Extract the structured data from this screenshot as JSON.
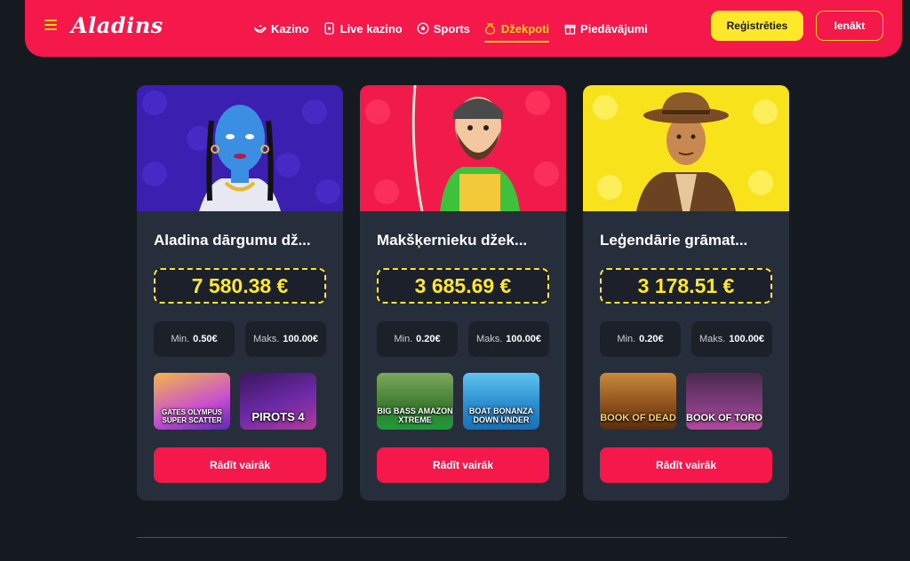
{
  "header": {
    "logo": "Aladins",
    "nav": [
      {
        "label": "Kazino",
        "icon": "lamp-icon"
      },
      {
        "label": "Live kazino",
        "icon": "card-icon"
      },
      {
        "label": "Sports",
        "icon": "ball-icon"
      },
      {
        "label": "Džekpoti",
        "icon": "moneybag-icon"
      },
      {
        "label": "Piedāvājumi",
        "icon": "gift-icon"
      }
    ],
    "register": "Reģistrēties",
    "login": "Ienākt"
  },
  "colors": {
    "brand": "#f5184a",
    "accent": "#ffe82a",
    "card": "#262d3b",
    "background": "#151920"
  },
  "cards": [
    {
      "title": "Aladina dārgumu dž...",
      "amount": "7 580.38 €",
      "min_label": "Min.",
      "min_value": "0.50€",
      "max_label": "Maks.",
      "max_value": "100.00€",
      "games": [
        {
          "label": "GATES OLYMPUS SUPER SCATTER"
        },
        {
          "label": "PIROTS 4"
        }
      ],
      "button": "Rādīt vairāk"
    },
    {
      "title": "Makšķernieku džek...",
      "amount": "3 685.69 €",
      "min_label": "Min.",
      "min_value": "0.20€",
      "max_label": "Maks.",
      "max_value": "100.00€",
      "games": [
        {
          "label": "BIG BASS AMAZON XTREME"
        },
        {
          "label": "BOAT BONANZA DOWN UNDER"
        }
      ],
      "button": "Rādīt vairāk"
    },
    {
      "title": "Leģendārie grāmat...",
      "amount": "3 178.51 €",
      "min_label": "Min.",
      "min_value": "0.20€",
      "max_label": "Maks.",
      "max_value": "100.00€",
      "games": [
        {
          "label": "BOOK OF DEAD"
        },
        {
          "label": "BOOK OF TORO"
        }
      ],
      "button": "Rādīt vairāk"
    }
  ]
}
